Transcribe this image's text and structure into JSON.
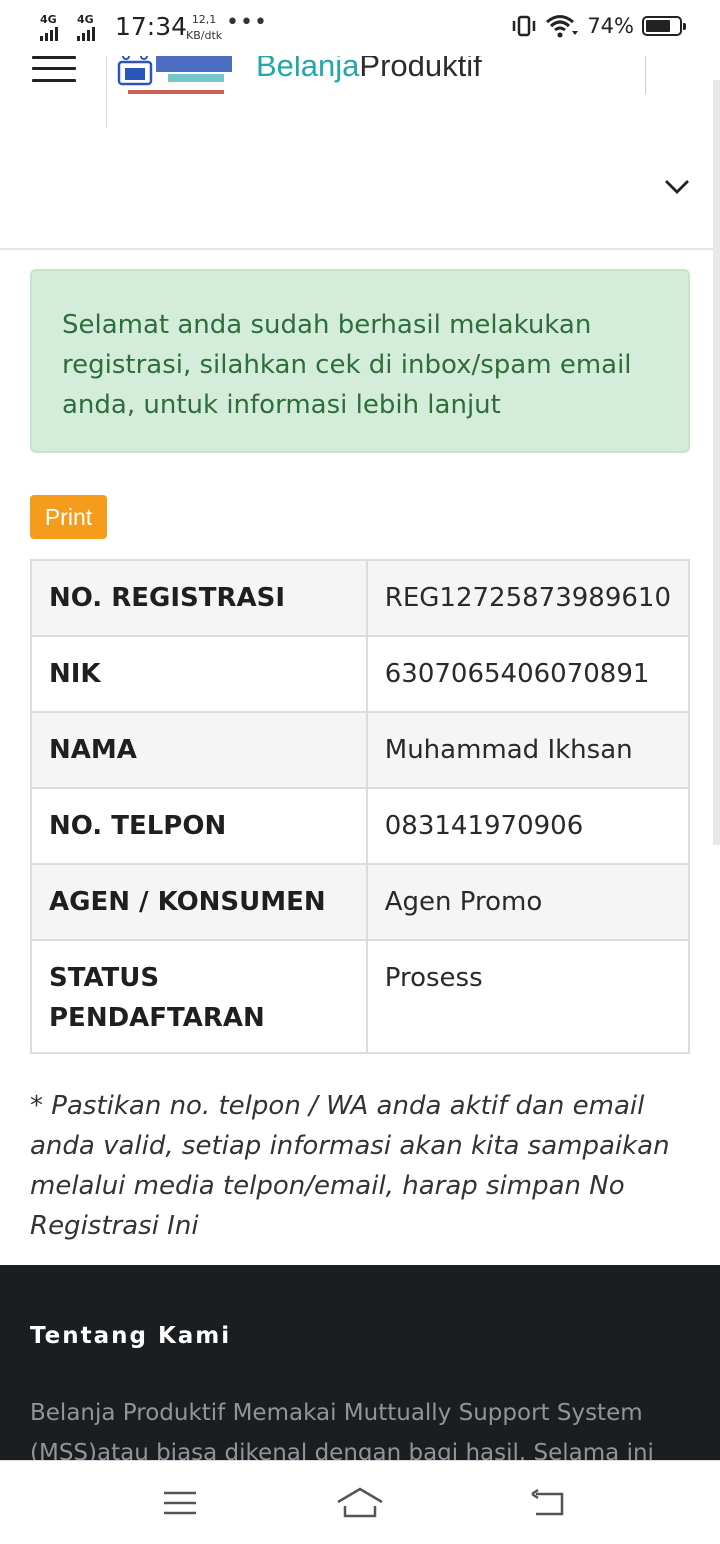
{
  "status_bar": {
    "net1": "4G",
    "net2": "4G",
    "time": "17:34",
    "speed_value": "12,1",
    "speed_unit": "KB/dtk",
    "more": "•••",
    "battery": "74%",
    "battery_level": 0.74
  },
  "header": {
    "logo_icon": "belanja-produktif-logo",
    "brand_part1": "Belanja",
    "brand_part2": "Produktif"
  },
  "alert": {
    "message": "Selamat anda sudah berhasil melakukan registrasi, silahkan cek di inbox/spam email anda, untuk informasi lebih lanjut"
  },
  "print_label": "Print",
  "table": [
    {
      "label": "NO. REGISTRASI",
      "value": "REG12725873989610"
    },
    {
      "label": "NIK",
      "value": "6307065406070891"
    },
    {
      "label": "NAMA",
      "value": "Muhammad Ikhsan"
    },
    {
      "label": "NO. TELPON",
      "value": "083141970906"
    },
    {
      "label": "AGEN / KONSUMEN",
      "value": "Agen Promo"
    },
    {
      "label": "STATUS PENDAFTARAN",
      "value": "Prosess"
    }
  ],
  "note": "* Pastikan no. telpon / WA anda aktif dan email anda valid, setiap informasi akan kita sampaikan melalui media telpon/email, harap simpan No Registrasi Ini",
  "footer": {
    "title": "Tentang Kami",
    "text": "Belanja Produktif Memakai Muttually Support System (MSS)atau biasa dikenal dengan bagi hasil. Selama ini"
  },
  "colors": {
    "brand_teal": "#22a8a8",
    "alert_bg": "#d4edda",
    "alert_text": "#2f6e3b",
    "print_button": "#f69c1d",
    "footer_bg": "#1b1e21"
  }
}
